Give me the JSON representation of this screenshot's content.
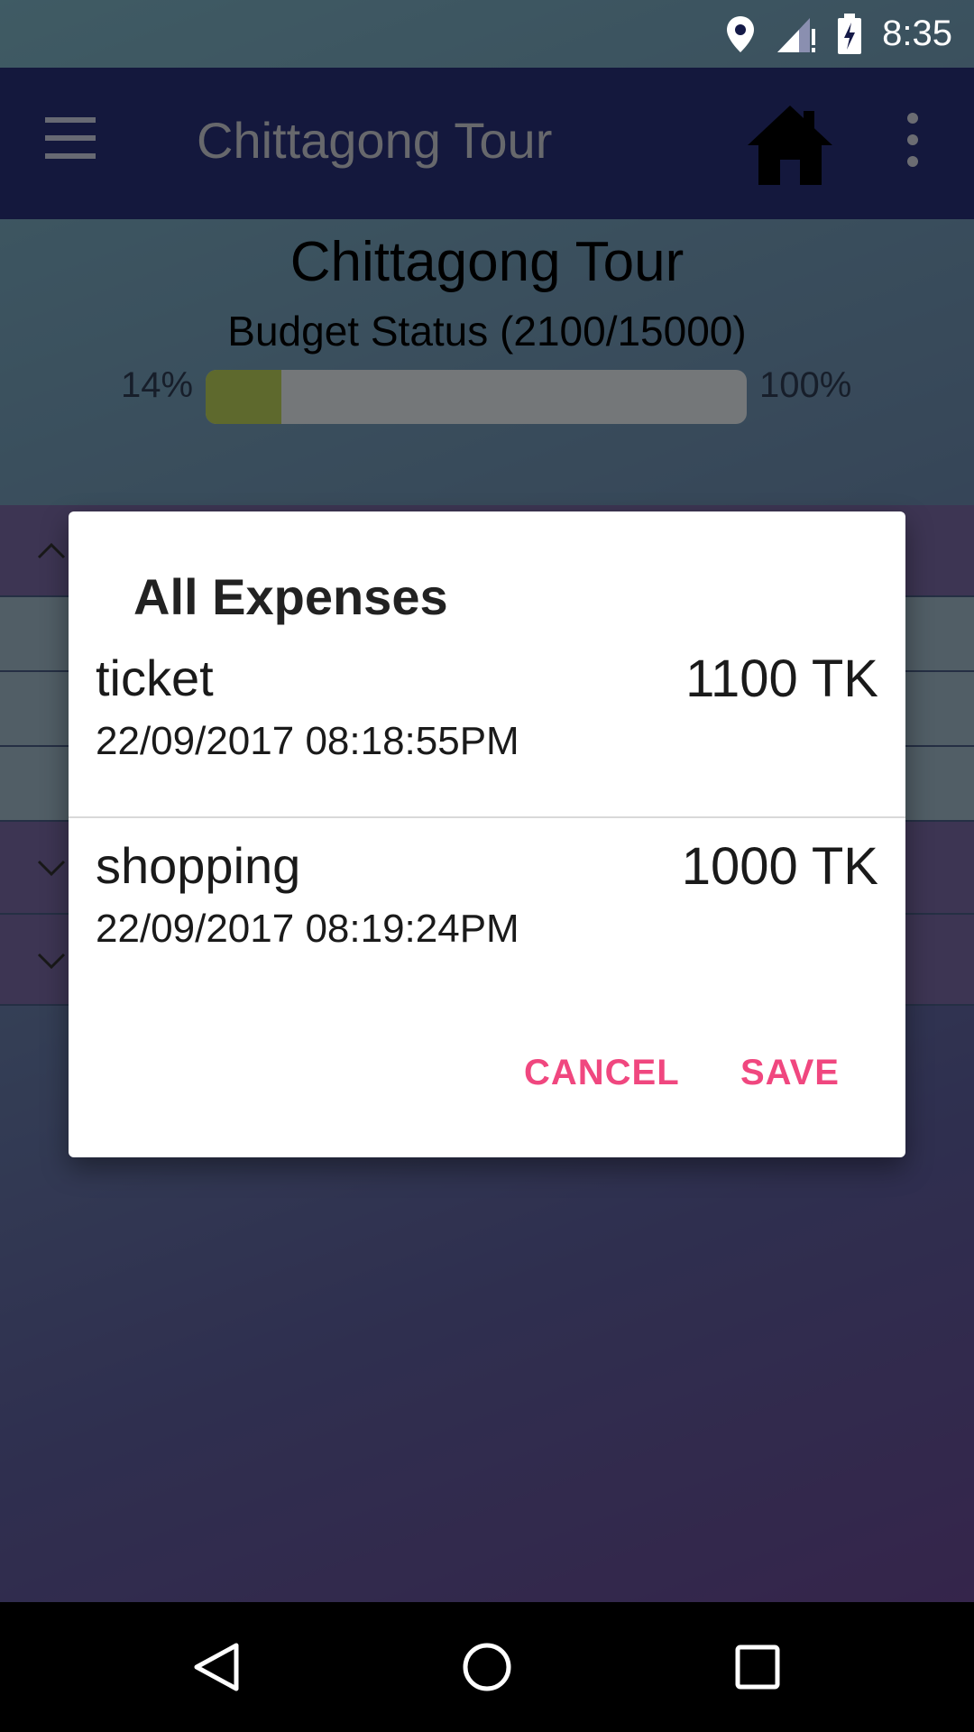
{
  "status_bar": {
    "time": "8:35",
    "icons": [
      "location-icon",
      "signal-icon",
      "battery-charging-icon"
    ]
  },
  "app_bar": {
    "title": "Chittagong Tour",
    "icons": [
      "menu-icon",
      "home-icon",
      "more-vert-icon"
    ]
  },
  "content": {
    "title": "Chittagong Tour",
    "budget_status": "Budget Status (2100/15000)",
    "progress_start_label": "14%",
    "progress_end_label": "100%",
    "progress_fraction": 0.14
  },
  "dialog": {
    "title": "All Expenses",
    "expenses": [
      {
        "name": "ticket",
        "amount": "1100 TK",
        "date": "22/09/2017 08:18:55PM"
      },
      {
        "name": "shopping",
        "amount": "1000 TK",
        "date": "22/09/2017 08:19:24PM"
      }
    ],
    "cancel_label": "CANCEL",
    "save_label": "SAVE"
  },
  "nav_bar": {
    "icons": [
      "back-icon",
      "home-circle-icon",
      "recents-icon"
    ]
  },
  "colors": {
    "status_bar": "#151a48",
    "app_bar": "#28307a",
    "accent": "#f0477f",
    "progress_fill": "#bcd35a"
  }
}
